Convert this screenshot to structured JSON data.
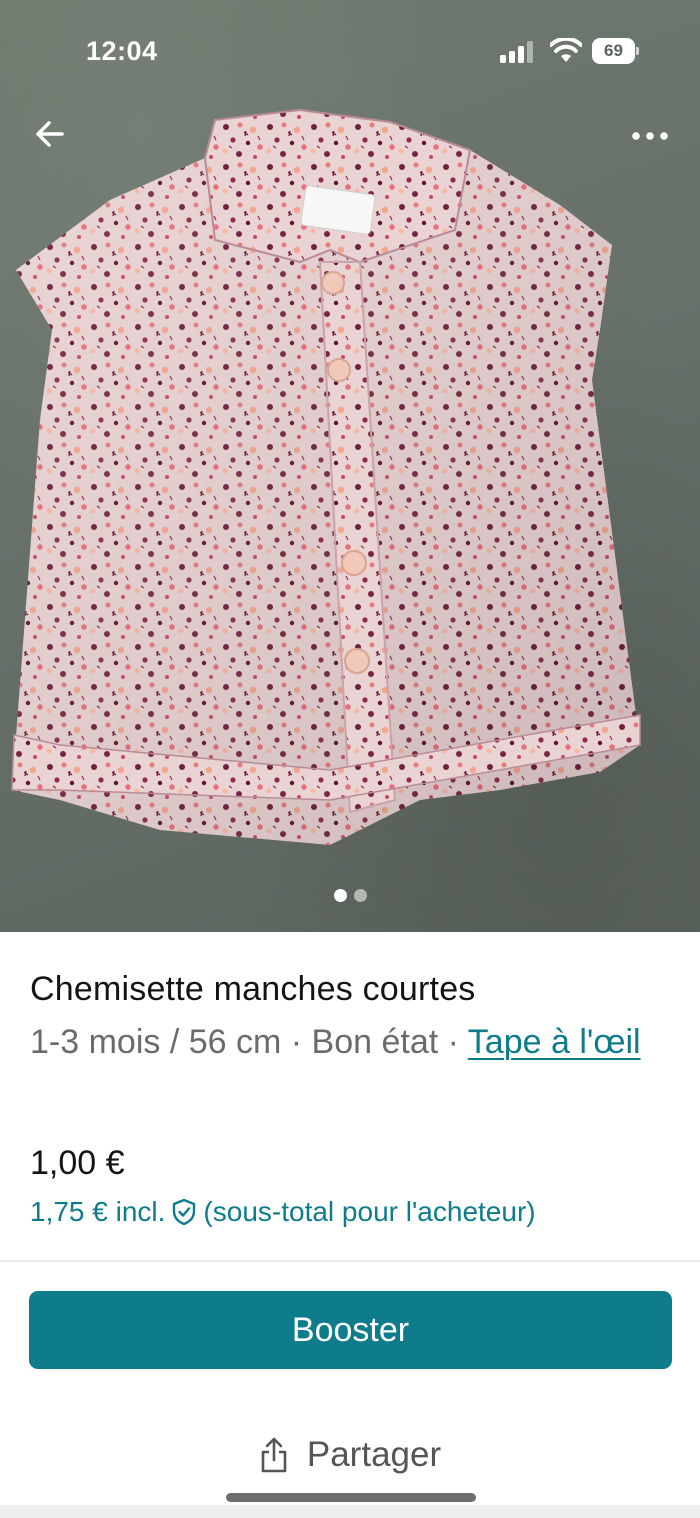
{
  "status_bar": {
    "time": "12:04",
    "battery": "69",
    "icons": [
      "signal-icon",
      "wifi-icon",
      "battery-icon"
    ]
  },
  "header": {
    "back_icon": "arrow-left-icon",
    "more_icon": "more-horizontal-icon"
  },
  "gallery": {
    "image_count": 2,
    "active_index": 0
  },
  "item": {
    "title": "Chemisette manches courtes",
    "size": "1-3 mois / 56 cm",
    "separator": " · ",
    "condition": "Bon état",
    "brand": "Tape à l'œil",
    "price": "1,00 €",
    "buyer_price": "1,75 € incl.",
    "buyer_price_note": "(sous-total pour l'acheteur)"
  },
  "actions": {
    "booster_label": "Booster",
    "share_label": "Partager"
  },
  "colors": {
    "accent": "#0f7c8c",
    "text_primary": "#141414",
    "text_secondary": "#6b6b6b",
    "background_photo": "#67716a"
  }
}
